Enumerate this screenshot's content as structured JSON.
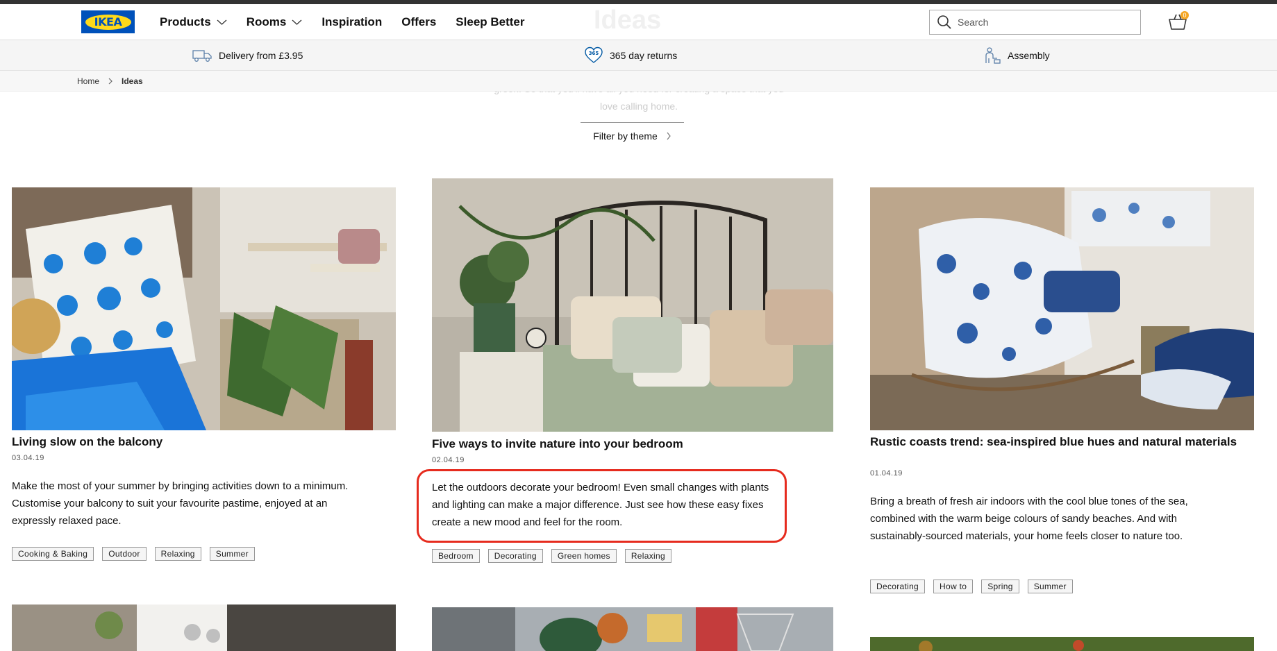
{
  "header": {
    "logo_text": "IKEA",
    "nav": [
      {
        "label": "Products",
        "has_dropdown": true
      },
      {
        "label": "Rooms",
        "has_dropdown": true
      },
      {
        "label": "Inspiration",
        "has_dropdown": false
      },
      {
        "label": "Offers",
        "has_dropdown": false
      },
      {
        "label": "Sleep Better",
        "has_dropdown": false
      }
    ],
    "ghost_title": "Ideas",
    "search_placeholder": "Search",
    "cart_count": "0"
  },
  "services": [
    {
      "label": "Delivery from £3.95",
      "icon": "truck-icon"
    },
    {
      "label": "365 day returns",
      "icon": "returns-heart-icon",
      "badge": "365"
    },
    {
      "label": "Assembly",
      "icon": "assembly-icon"
    }
  ],
  "breadcrumb": {
    "home": "Home",
    "current": "Ideas"
  },
  "intro_text": "This section is filled with handy home ideas, from home decoration ideas to organising tips to inspiration for making your home more green. So that you'll have all you need for creating a space that you love calling home.",
  "filter": {
    "label": "Filter by theme"
  },
  "cards": [
    {
      "title": "Living slow on the balcony",
      "date": "03.04.19",
      "description": "Make the most of your summer by bringing activities down to a minimum. Customise your balcony to suit your favourite pastime, enjoyed at an expressly relaxed pace.",
      "tags": [
        "Cooking & Baking",
        "Outdoor",
        "Relaxing",
        "Summer"
      ]
    },
    {
      "title": "Five ways to invite nature into your bedroom",
      "date": "02.04.19",
      "description": "Let the outdoors decorate your bedroom! Even small changes with plants and lighting can make a major difference. Just see how these easy fixes create a new mood and feel for the room.",
      "tags": [
        "Bedroom",
        "Decorating",
        "Green homes",
        "Relaxing"
      ]
    },
    {
      "title": "Rustic coasts trend: sea-inspired blue hues and natural materials",
      "date": "01.04.19",
      "description": "Bring a breath of fresh air indoors with the cool blue tones of the sea, combined with the warm beige colours of sandy beaches. And with sustainably-sourced materials, your home feels closer to nature too.",
      "tags": [
        "Decorating",
        "How to",
        "Spring",
        "Summer"
      ]
    }
  ],
  "colors": {
    "brand_blue": "#0051ba",
    "brand_yellow": "#ffda1a",
    "highlight": "#e62b1e",
    "cart_badge": "#f5a623"
  }
}
